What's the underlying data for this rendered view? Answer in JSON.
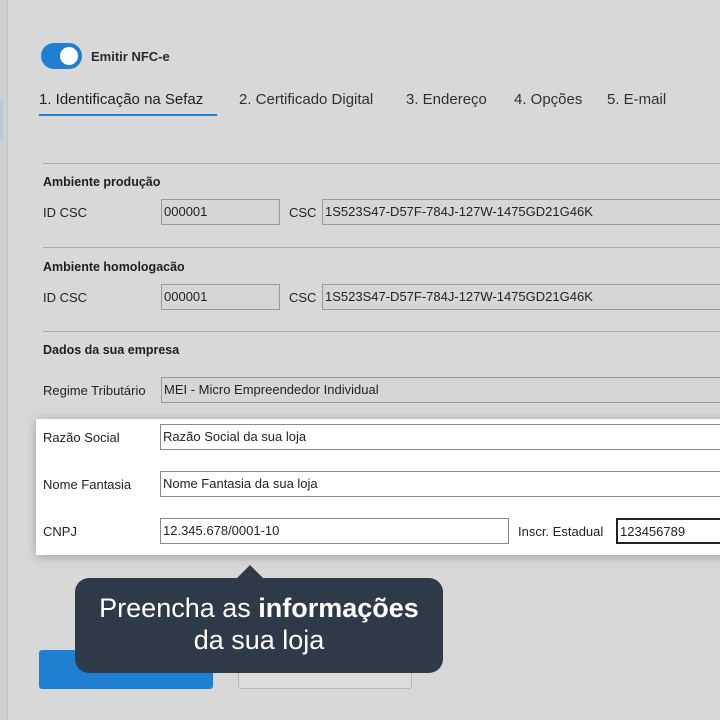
{
  "toggle": {
    "label": "Emitir NFC-e",
    "on": true
  },
  "tabs": [
    {
      "label": "1. Identificação na Sefaz",
      "active": true
    },
    {
      "label": "2. Certificado Digital",
      "active": false
    },
    {
      "label": "3. Endereço",
      "active": false
    },
    {
      "label": "4. Opções",
      "active": false
    },
    {
      "label": "5. E-mail",
      "active": false
    }
  ],
  "producao": {
    "title": "Ambiente produção",
    "id_csc_label": "ID CSC",
    "id_csc_value": "000001",
    "csc_label": "CSC",
    "csc_value": "1S523S47-D57F-784J-127W-1475GD21G46K"
  },
  "homologacao": {
    "title": "Ambiente homologacão",
    "id_csc_label": "ID CSC",
    "id_csc_value": "000001",
    "csc_label": "CSC",
    "csc_value": "1S523S47-D57F-784J-127W-1475GD21G46K"
  },
  "empresa": {
    "title": "Dados da sua empresa",
    "regime_label": "Regime Tributário",
    "regime_value": "MEI - Micro Empreendedor Individual",
    "razao_label": "Razão Social",
    "razao_value": "Razão Social da sua loja",
    "fantasia_label": "Nome Fantasia",
    "fantasia_value": "Nome Fantasia da sua loja",
    "cnpj_label": "CNPJ",
    "cnpj_value": "12.345.678/0001-10",
    "ie_label": "Inscr. Estadual",
    "ie_value": "123456789"
  },
  "tooltip": {
    "line1_prefix": "Preencha as ",
    "line1_bold": "informações",
    "line2": "da sua loja"
  },
  "colors": {
    "accent": "#1f7fd3",
    "tooltip_bg": "#2e3a48",
    "background": "#d8d8d8"
  }
}
